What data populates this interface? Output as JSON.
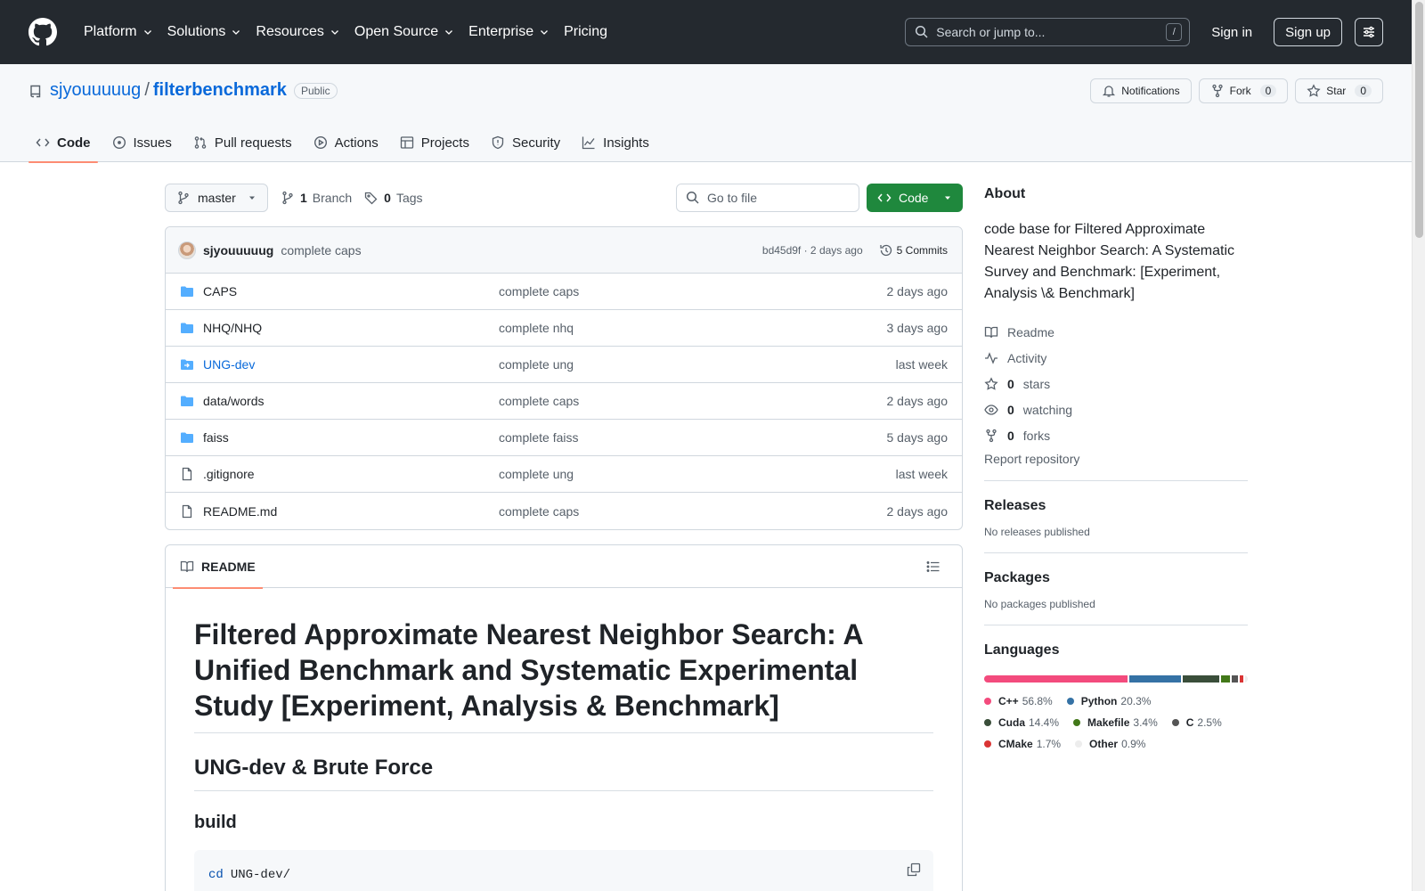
{
  "header": {
    "nav": [
      {
        "label": "Platform",
        "dropdown": true
      },
      {
        "label": "Solutions",
        "dropdown": true
      },
      {
        "label": "Resources",
        "dropdown": true
      },
      {
        "label": "Open Source",
        "dropdown": true
      },
      {
        "label": "Enterprise",
        "dropdown": true
      },
      {
        "label": "Pricing",
        "dropdown": false
      }
    ],
    "search_placeholder": "Search or jump to...",
    "search_shortcut": "/",
    "sign_in": "Sign in",
    "sign_up": "Sign up"
  },
  "repo": {
    "owner": "sjyouuuuug",
    "separator": "/",
    "name": "filterbenchmark",
    "visibility": "Public",
    "notifications_label": "Notifications",
    "fork_label": "Fork",
    "fork_count": "0",
    "star_label": "Star",
    "star_count": "0",
    "tabs": [
      {
        "label": "Code",
        "icon": "code-icon",
        "active": true
      },
      {
        "label": "Issues",
        "icon": "issue-icon"
      },
      {
        "label": "Pull requests",
        "icon": "pull-request-icon"
      },
      {
        "label": "Actions",
        "icon": "play-icon"
      },
      {
        "label": "Projects",
        "icon": "table-icon"
      },
      {
        "label": "Security",
        "icon": "shield-icon"
      },
      {
        "label": "Insights",
        "icon": "graph-icon"
      }
    ]
  },
  "toolbar": {
    "branch": "master",
    "branch_count": "1",
    "branch_label": "Branch",
    "tag_count": "0",
    "tag_label": "Tags",
    "goto_placeholder": "Go to file",
    "code_button": "Code"
  },
  "latest_commit": {
    "author": "sjyouuuuug",
    "message": "complete caps",
    "hash_and_time": "bd45d9f · 2 days ago",
    "commits_label": "5 Commits"
  },
  "files": [
    {
      "name": "CAPS",
      "type": "folder",
      "message": "complete caps",
      "date": "2 days ago"
    },
    {
      "name": "NHQ/NHQ",
      "type": "folder",
      "message": "complete nhq",
      "date": "3 days ago"
    },
    {
      "name": "UNG-dev",
      "type": "submodule",
      "message": "complete ung",
      "date": "last week"
    },
    {
      "name": "data/words",
      "type": "folder",
      "message": "complete caps",
      "date": "2 days ago"
    },
    {
      "name": "faiss",
      "type": "folder",
      "message": "complete faiss",
      "date": "5 days ago"
    },
    {
      "name": ".gitignore",
      "type": "file",
      "message": "complete ung",
      "date": "last week"
    },
    {
      "name": "README.md",
      "type": "file",
      "message": "complete caps",
      "date": "2 days ago"
    }
  ],
  "readme": {
    "tab_label": "README",
    "h1": "Filtered Approximate Nearest Neighbor Search: A Unified Benchmark and Systematic Experimental Study [Experiment, Analysis & Benchmark]",
    "h2": "UNG-dev & Brute Force",
    "h3": "build",
    "code_keyword": "cd",
    "code_arg": "UNG-dev/"
  },
  "about": {
    "title": "About",
    "description": "code base for Filtered Approximate Nearest Neighbor Search: A Systematic Survey and Benchmark: [Experiment, Analysis \\& Benchmark]",
    "links": [
      {
        "icon": "book-icon",
        "count": "",
        "label": "Readme"
      },
      {
        "icon": "pulse-icon",
        "count": "",
        "label": "Activity"
      },
      {
        "icon": "star-icon",
        "count": "0",
        "label": "stars"
      },
      {
        "icon": "eye-icon",
        "count": "0",
        "label": "watching"
      },
      {
        "icon": "fork-icon",
        "count": "0",
        "label": "forks"
      }
    ],
    "report": "Report repository"
  },
  "releases": {
    "title": "Releases",
    "text": "No releases published"
  },
  "packages": {
    "title": "Packages",
    "text": "No packages published"
  },
  "languages": {
    "title": "Languages",
    "items": [
      {
        "name": "C++",
        "percent": "56.8%",
        "value": 56.8,
        "color": "#f34b7d"
      },
      {
        "name": "Python",
        "percent": "20.3%",
        "value": 20.3,
        "color": "#3572A5"
      },
      {
        "name": "Cuda",
        "percent": "14.4%",
        "value": 14.4,
        "color": "#3A4E3A"
      },
      {
        "name": "Makefile",
        "percent": "3.4%",
        "value": 3.4,
        "color": "#427819"
      },
      {
        "name": "C",
        "percent": "2.5%",
        "value": 2.5,
        "color": "#555555"
      },
      {
        "name": "CMake",
        "percent": "1.7%",
        "value": 1.7,
        "color": "#DA3434"
      },
      {
        "name": "Other",
        "percent": "0.9%",
        "value": 0.9,
        "color": "#ededed"
      }
    ]
  }
}
